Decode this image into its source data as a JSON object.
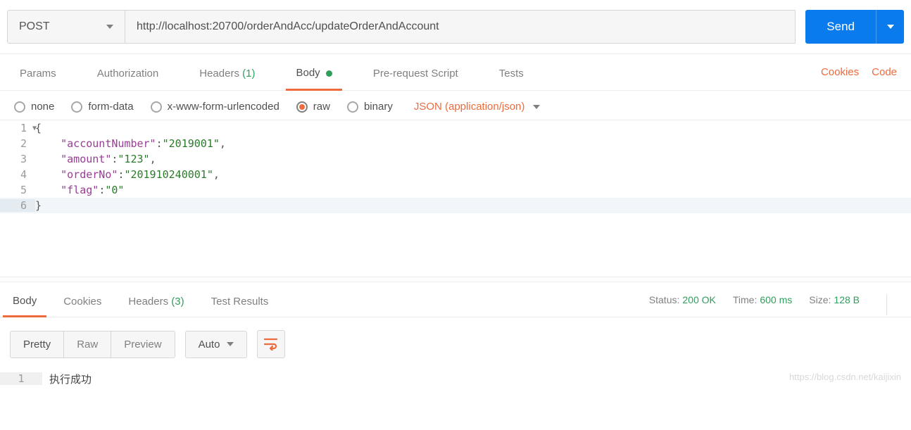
{
  "request": {
    "method": "POST",
    "url": "http://localhost:20700/orderAndAcc/updateOrderAndAccount",
    "send_label": "Send"
  },
  "tabs": {
    "params": "Params",
    "auth": "Authorization",
    "headers_label": "Headers",
    "headers_count": "(1)",
    "body": "Body",
    "prerequest": "Pre-request Script",
    "tests": "Tests",
    "cookies": "Cookies",
    "code": "Code"
  },
  "body_types": {
    "none": "none",
    "form_data": "form-data",
    "xwww": "x-www-form-urlencoded",
    "raw": "raw",
    "binary": "binary",
    "content_type": "JSON (application/json)"
  },
  "editor": {
    "ln1": "{",
    "ln2_k": "\"accountNumber\"",
    "ln2_v": "\"2019001\"",
    "ln3_k": "\"amount\"",
    "ln3_v": "\"123\"",
    "ln4_k": "\"orderNo\"",
    "ln4_v": "\"201910240001\"",
    "ln5_k": "\"flag\"",
    "ln5_v": "\"0\"",
    "ln6": "}"
  },
  "response": {
    "tabs": {
      "body": "Body",
      "cookies": "Cookies",
      "headers_label": "Headers",
      "headers_count": "(3)",
      "test_results": "Test Results"
    },
    "status_label": "Status:",
    "status_value": "200 OK",
    "time_label": "Time:",
    "time_value": "600 ms",
    "size_label": "Size:",
    "size_value": "128 B",
    "view": {
      "pretty": "Pretty",
      "raw": "Raw",
      "preview": "Preview",
      "auto": "Auto"
    },
    "body_text": "执行成功"
  },
  "watermark": "https://blog.csdn.net/kaijixin"
}
